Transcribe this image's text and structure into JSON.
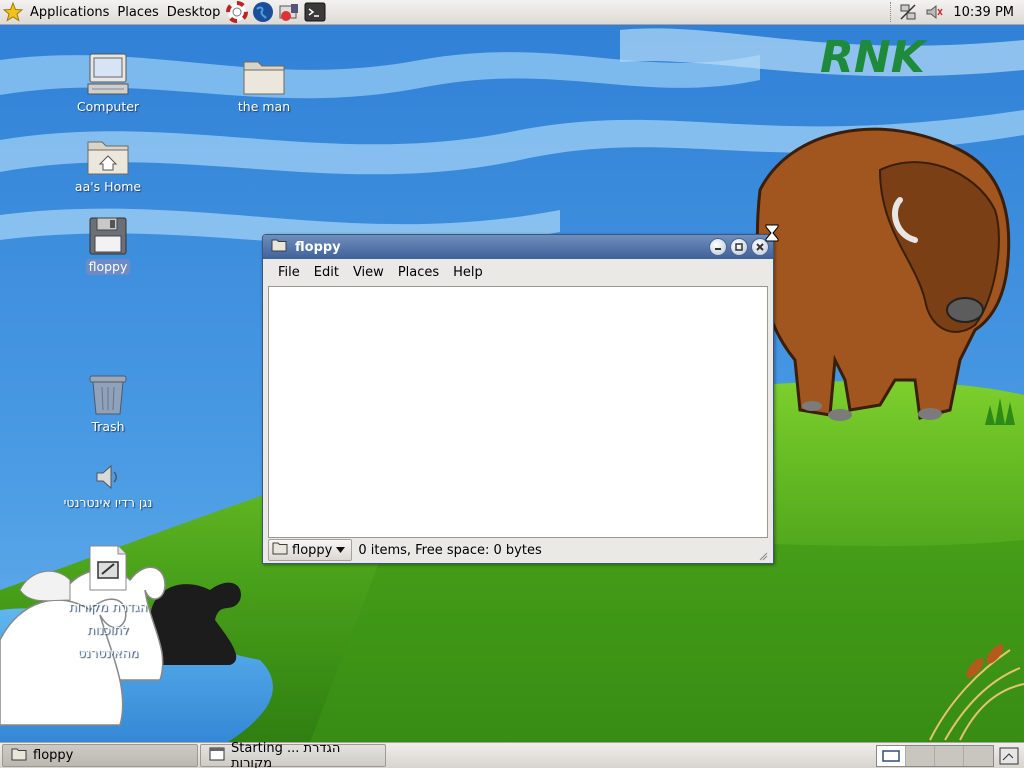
{
  "top_panel": {
    "menus": [
      "Applications",
      "Places",
      "Desktop"
    ],
    "clock": "10:39 PM"
  },
  "wallpaper": {
    "logo_text": "RNK"
  },
  "desktop_icons": [
    {
      "label": "Computer",
      "icon": "computer-icon"
    },
    {
      "label": "the man",
      "icon": "folder-icon"
    },
    {
      "label": "aa's Home",
      "icon": "home-folder-icon"
    },
    {
      "label": "floppy",
      "icon": "floppy-icon"
    },
    {
      "label": "Trash",
      "icon": "trash-icon"
    },
    {
      "label": "נגן רדיו אינטרנטי",
      "icon": "speaker-icon"
    },
    {
      "label": "הגדרת מקורות לתוכנות מהאינטרנט",
      "icon": "document-icon"
    }
  ],
  "window": {
    "title": "floppy",
    "menus": [
      "File",
      "Edit",
      "View",
      "Places",
      "Help"
    ],
    "location": "floppy",
    "status": "0 items, Free space: 0 bytes"
  },
  "taskbar": {
    "tasks": [
      {
        "label": "floppy",
        "active": true
      },
      {
        "label": "Starting ... הגדרת מקורות",
        "active": false
      }
    ],
    "workspaces": 4
  }
}
